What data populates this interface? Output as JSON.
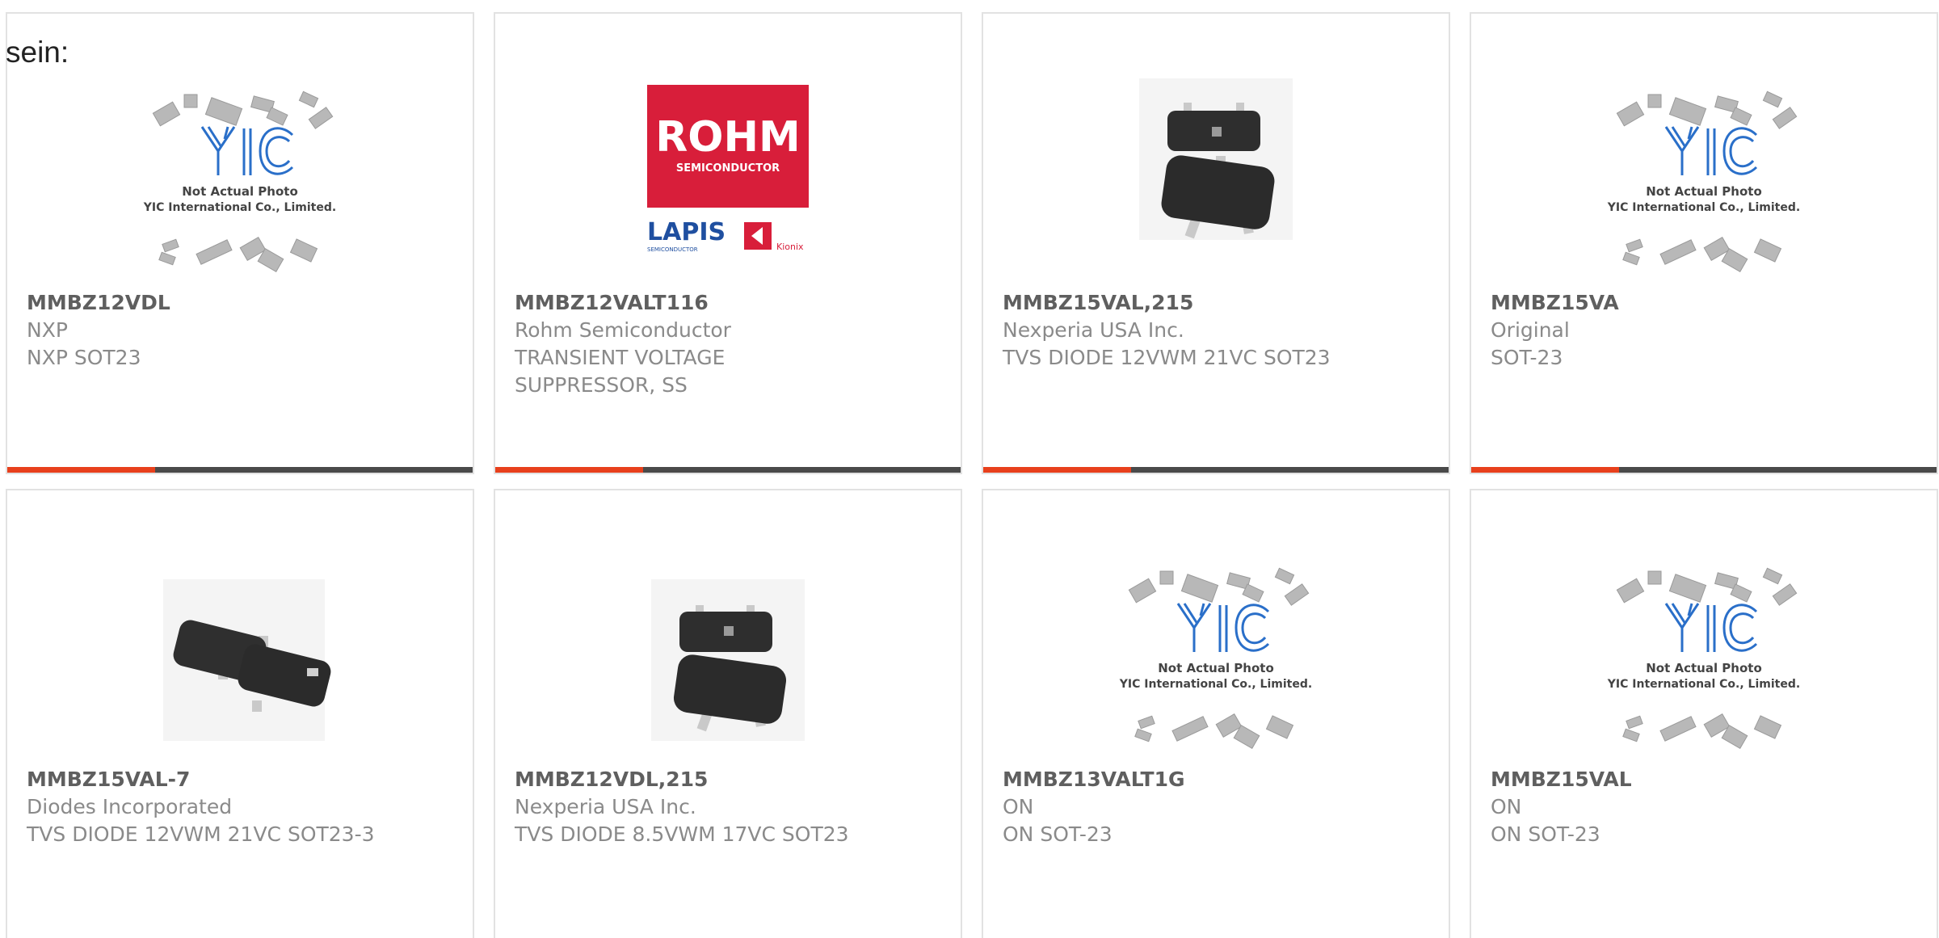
{
  "intro_text": "sein:",
  "accent_color": "#e8401c",
  "products": [
    {
      "part": "MMBZ12VDL",
      "manufacturer": "NXP",
      "description": "NXP SOT23",
      "image": "yic-placeholder",
      "img_text": {
        "line1": "Not Actual Photo",
        "line2": "YIC International Co., Limited."
      }
    },
    {
      "part": "MMBZ12VALT116",
      "manufacturer": "Rohm Semiconductor",
      "description": "TRANSIENT VOLTAGE SUPPRESSOR, SS",
      "image": "rohm-logo",
      "img_text": {
        "brand": "ROHM",
        "sub": "SEMICONDUCTOR",
        "lapis": "LAPIS",
        "lapis_sub": "SEMICONDUCTOR",
        "kionix": "Kionix"
      }
    },
    {
      "part": "MMBZ15VAL,215",
      "manufacturer": "Nexperia USA Inc.",
      "description": "TVS DIODE 12VWM 21VC SOT23",
      "image": "sot23-vertical"
    },
    {
      "part": "MMBZ15VA",
      "manufacturer": "Original",
      "description": "SOT-23",
      "image": "yic-placeholder",
      "img_text": {
        "line1": "Not Actual Photo",
        "line2": "YIC International Co., Limited."
      }
    },
    {
      "part": "MMBZ15VAL-7",
      "manufacturer": "Diodes Incorporated",
      "description": "TVS DIODE 12VWM 21VC SOT23-3",
      "image": "sot23-horizontal"
    },
    {
      "part": "MMBZ12VDL,215",
      "manufacturer": "Nexperia USA Inc.",
      "description": "TVS DIODE 8.5VWM 17VC SOT23",
      "image": "sot23-vertical"
    },
    {
      "part": "MMBZ13VALT1G",
      "manufacturer": "ON",
      "description": "ON SOT-23",
      "image": "yic-placeholder",
      "img_text": {
        "line1": "Not Actual Photo",
        "line2": "YIC International Co., Limited."
      }
    },
    {
      "part": "MMBZ15VAL",
      "manufacturer": "ON",
      "description": "ON SOT-23",
      "image": "yic-placeholder",
      "img_text": {
        "line1": "Not Actual Photo",
        "line2": "YIC International Co., Limited."
      }
    }
  ]
}
